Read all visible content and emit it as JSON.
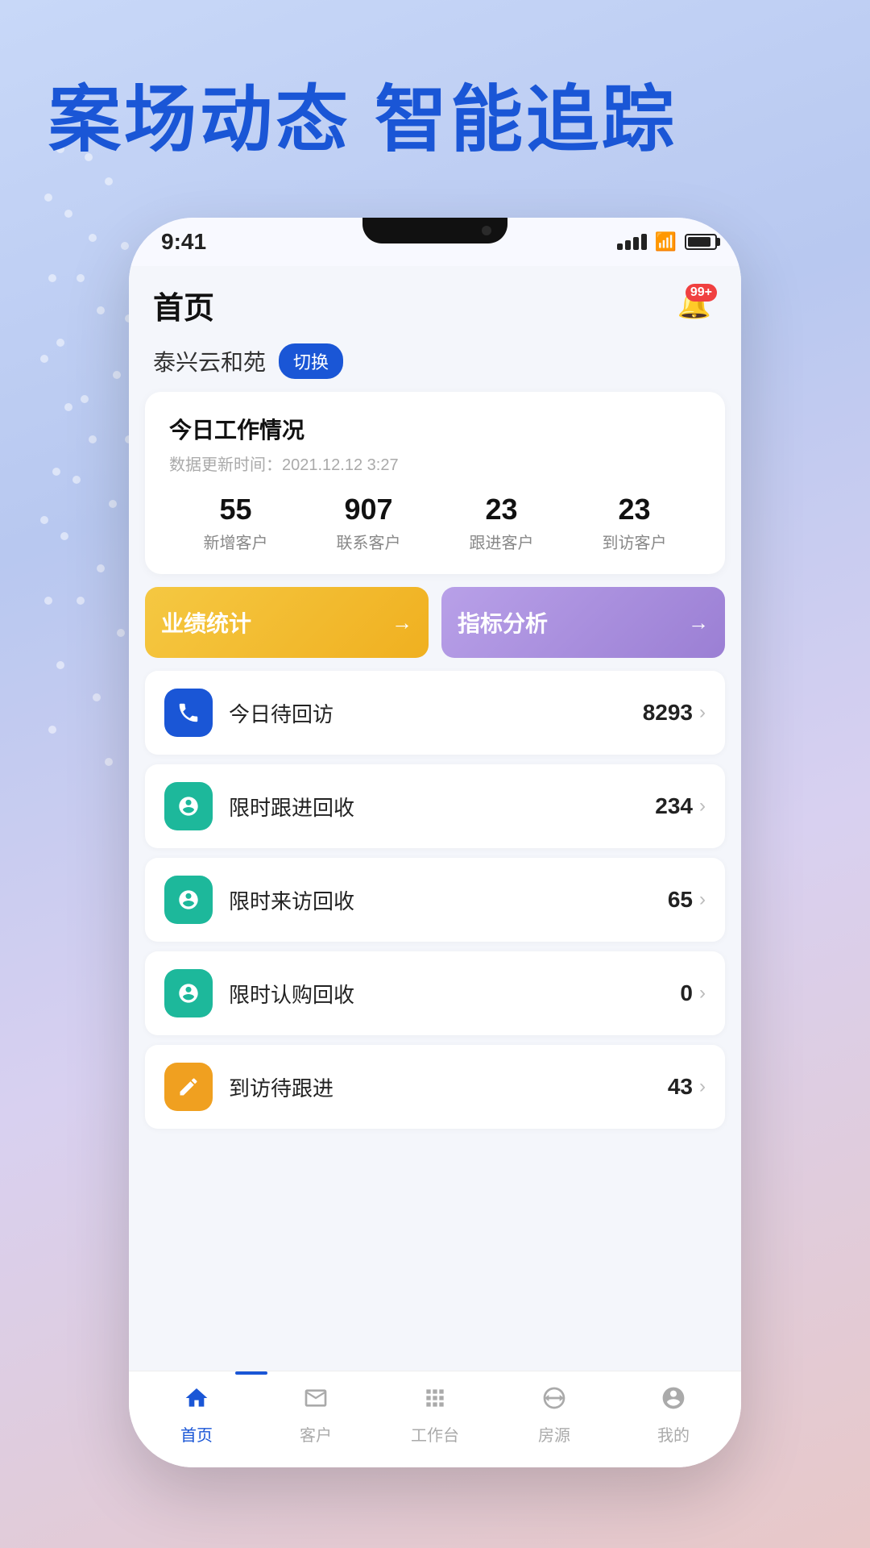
{
  "background": {
    "gradient_start": "#c8d8f8",
    "gradient_end": "#e8c8c8"
  },
  "hero": {
    "line1": "案场动态  智能追踪"
  },
  "status_bar": {
    "time": "9:41",
    "badge_notif": "99+"
  },
  "header": {
    "title": "首页",
    "notification_badge": "99+"
  },
  "project": {
    "name": "泰兴云和苑",
    "switch_label": "切换"
  },
  "work_card": {
    "title": "今日工作情况",
    "update_time": "数据更新时间：2021.12.12  3:27",
    "stats": [
      {
        "num": "55",
        "label": "新增客户"
      },
      {
        "num": "907",
        "label": "联系客户"
      },
      {
        "num": "23",
        "label": "跟进客户"
      },
      {
        "num": "23",
        "label": "到访客户"
      }
    ]
  },
  "action_buttons": [
    {
      "label": "业绩统计",
      "arrow": "→",
      "style": "yellow"
    },
    {
      "label": "指标分析",
      "arrow": "→",
      "style": "purple"
    }
  ],
  "list_items": [
    {
      "icon": "📞",
      "icon_style": "blue",
      "label": "今日待回访",
      "count": "8293"
    },
    {
      "icon": "⏰",
      "icon_style": "teal",
      "label": "限时跟进回收",
      "count": "234"
    },
    {
      "icon": "⏰",
      "icon_style": "teal",
      "label": "限时来访回收",
      "count": "65"
    },
    {
      "icon": "⏰",
      "icon_style": "teal",
      "label": "限时认购回收",
      "count": "0"
    },
    {
      "icon": "✏️",
      "icon_style": "orange",
      "label": "到访待跟进",
      "count": "43"
    }
  ],
  "bottom_nav": [
    {
      "label": "首页",
      "icon": "🏠",
      "active": true
    },
    {
      "label": "客户",
      "icon": "🪪",
      "active": false
    },
    {
      "label": "工作台",
      "icon": "⠿",
      "active": false
    },
    {
      "label": "房源",
      "icon": "🏢",
      "active": false
    },
    {
      "label": "我的",
      "icon": "😊",
      "active": false
    }
  ]
}
